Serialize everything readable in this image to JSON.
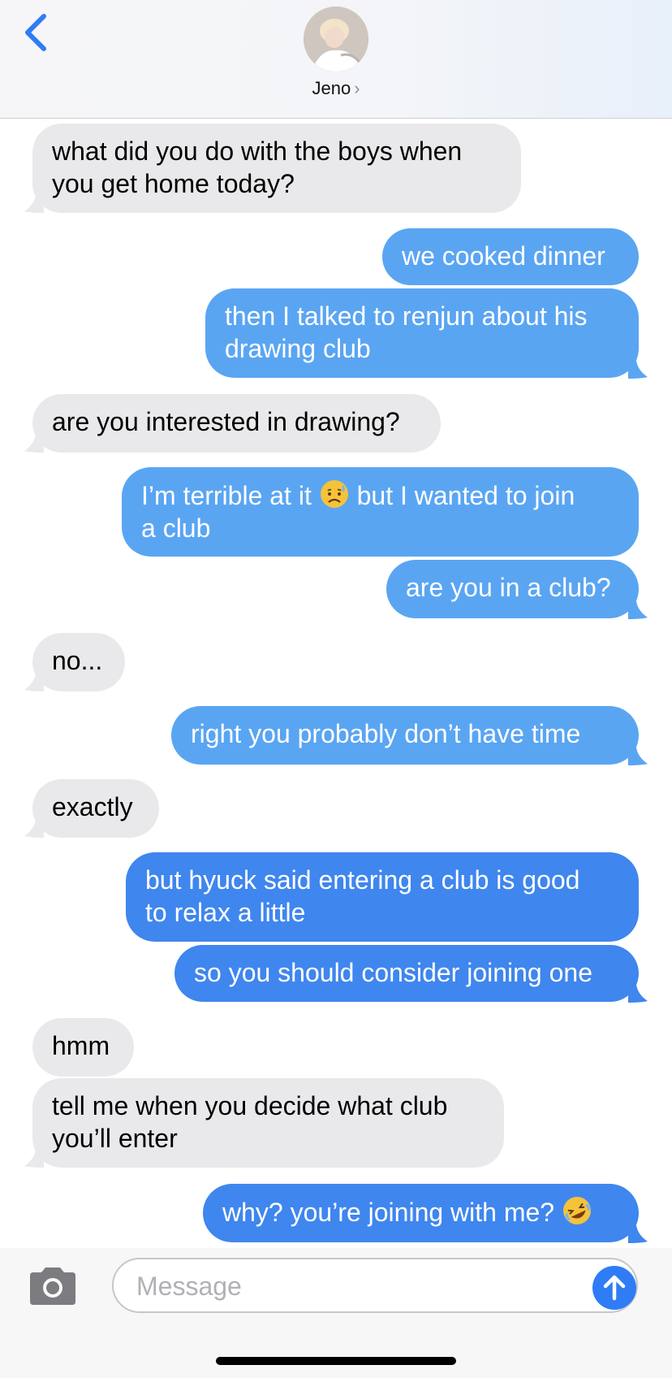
{
  "header": {
    "contact_name": "Jeno"
  },
  "messages": [
    {
      "side": "in",
      "lines": [
        "what did you do with the boys when",
        "you get home today?"
      ]
    },
    {
      "side": "out",
      "lines": [
        "we cooked dinner"
      ]
    },
    {
      "side": "out",
      "lines": [
        "then I talked to renjun about his",
        "drawing club"
      ]
    },
    {
      "side": "in",
      "lines": [
        "are you interested in drawing?"
      ]
    },
    {
      "side": "out",
      "lines": [
        "I’m terrible at it",
        "but I wanted to join",
        "a club"
      ],
      "emoji": "sad-sweat-face"
    },
    {
      "side": "out",
      "lines": [
        "are you in a club?"
      ]
    },
    {
      "side": "in",
      "lines": [
        "no..."
      ]
    },
    {
      "side": "out",
      "lines": [
        "right you probably don’t have time"
      ]
    },
    {
      "side": "in",
      "lines": [
        "exactly"
      ]
    },
    {
      "side": "out",
      "lines": [
        "but hyuck said entering a club is good",
        "to relax a little"
      ]
    },
    {
      "side": "out",
      "lines": [
        "so you should consider joining one"
      ]
    },
    {
      "side": "in",
      "lines": [
        "hmm"
      ]
    },
    {
      "side": "in",
      "lines": [
        "tell me when you decide what club",
        "you’ll enter"
      ]
    },
    {
      "side": "out",
      "lines": [
        "why? you’re joining with me?"
      ],
      "emoji": "rolling-laughing-face"
    }
  ],
  "composer": {
    "placeholder": "Message"
  },
  "colors": {
    "incoming": "#e9e9eb",
    "outgoing": "#5aa5f2",
    "outgoing_deep": "#3f86ee",
    "accent": "#2f7cf6"
  }
}
